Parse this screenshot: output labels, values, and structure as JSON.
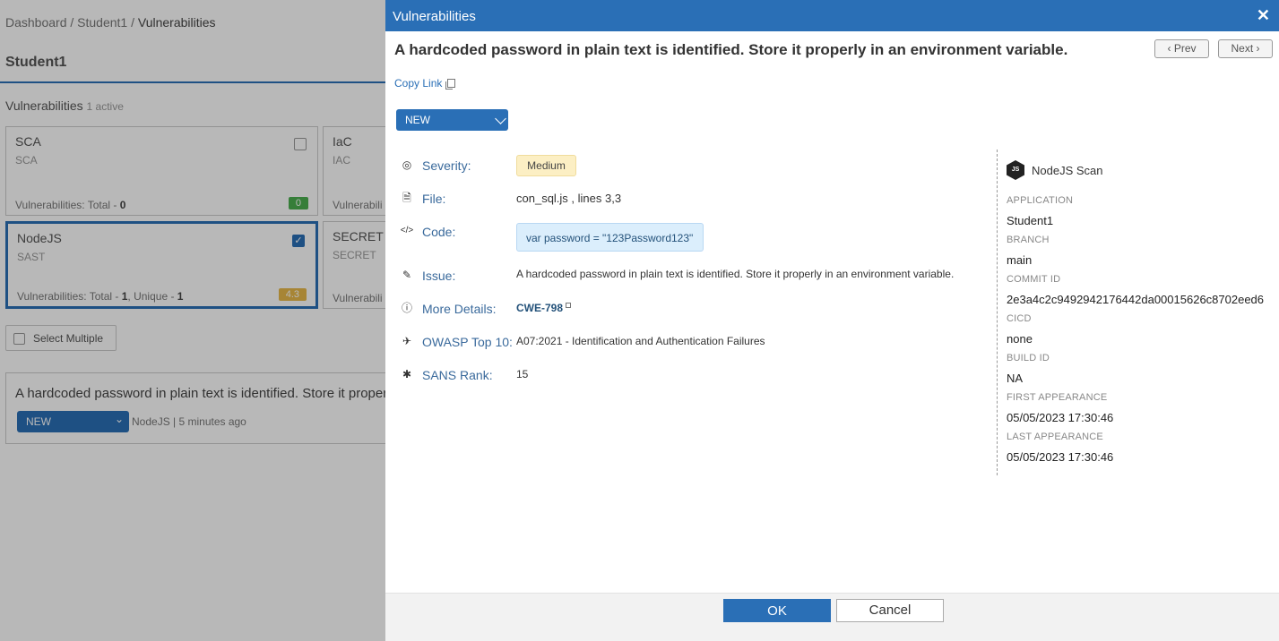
{
  "colors": {
    "accent": "#2a6fb6",
    "severity_medium_bg": "#fcefc4",
    "code_bg": "#dbeefc",
    "sca_badge": "#4caf50",
    "nodejs_badge": "#e8b94a"
  },
  "background": {
    "breadcrumb": {
      "part1": "Dashboard / Student1 / ",
      "current": "Vulnerabilities"
    },
    "page_title": "Student1",
    "vulnerabilities": {
      "label": "Vulnerabilities",
      "sub": "1 active"
    },
    "cards": [
      {
        "title": "SCA",
        "sub": "SCA",
        "foot_prefix": "Vulnerabilities: Total - ",
        "total": "0",
        "badge": "0"
      },
      {
        "title": "IaC",
        "sub": "IAC",
        "foot_prefix": "Vulnerabili"
      },
      {
        "title": "NodeJS",
        "sub": "SAST",
        "foot_prefix": "Vulnerabilities: Total - ",
        "total": "1",
        "unique_prefix": ", Unique - ",
        "unique": "1",
        "badge": "4.3"
      },
      {
        "title": "SECRET",
        "sub": "SECRET",
        "foot_prefix": "Vulnerabili"
      }
    ],
    "select_multiple": "Select Multiple",
    "list_item": {
      "title": "A hardcoded password in plain text is identified. Store it properl",
      "status": "NEW",
      "meta": "NodeJS | 5 minutes ago"
    }
  },
  "modal": {
    "header_title": "Vulnerabilities",
    "close": "✕",
    "title": "A hardcoded password in plain text is identified. Store it properly in an environment variable.",
    "prev": "‹ Prev",
    "next": "Next ›",
    "copy_link": "Copy Link",
    "status": "NEW",
    "details": {
      "severity_label": "Severity:",
      "severity_value": "Medium",
      "file_label": "File:",
      "file_value": "con_sql.js , lines 3,3",
      "code_label": "Code:",
      "code_value": "var password = \"123Password123\"",
      "issue_label": "Issue:",
      "issue_value": "A hardcoded password in plain text is identified. Store it properly in an environment variable.",
      "more_label": "More Details:",
      "more_value": "CWE-798",
      "owasp_label": "OWASP Top 10:",
      "owasp_value": "A07:2021 - Identification and Authentication Failures",
      "sans_label": "SANS Rank:",
      "sans_value": "15"
    },
    "side": {
      "scan_name": "NodeJS Scan",
      "scan_icon_text": "JS",
      "application_label": "APPLICATION",
      "application": "Student1",
      "branch_label": "BRANCH",
      "branch": "main",
      "commit_label": "COMMIT ID",
      "commit": "2e3a4c2c9492942176442da00015626c8702eed6",
      "cicd_label": "CICD",
      "cicd": "none",
      "build_label": "BUILD ID",
      "build": "NA",
      "first_label": "FIRST APPEARANCE",
      "first": "05/05/2023 17:30:46",
      "last_label": "LAST APPEARANCE",
      "last": "05/05/2023 17:30:46"
    },
    "ok": "OK",
    "cancel": "Cancel"
  }
}
